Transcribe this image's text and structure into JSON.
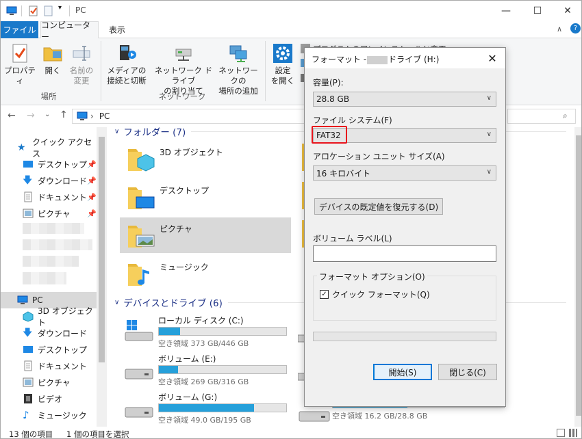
{
  "window": {
    "title": "PC",
    "controls": {
      "minimize": "—",
      "maximize": "☐",
      "close": "✕"
    }
  },
  "tabs": {
    "file": "ファイル",
    "computer": "コンピューター",
    "view": "表示"
  },
  "ribbon": {
    "properties": "プロパティ",
    "open": "開く",
    "rename_line1": "名前の",
    "rename_line2": "変更",
    "group_location": "場所",
    "media_line1": "メディアの",
    "media_line2": "接続と切断",
    "mapdrive_line1": "ネットワーク ドライブ",
    "mapdrive_line2": "の割り当て",
    "addnet_line1": "ネットワークの",
    "addnet_line2": "場所の追加",
    "group_network": "ネットワーク",
    "settings_line1": "設定",
    "settings_line2": "を開く",
    "uninstall": "プログラムのアンインストールと変更"
  },
  "address": {
    "path": "PC"
  },
  "sidebar": {
    "quick_access": "クイック アクセス",
    "quick_items": [
      "デスクトップ",
      "ダウンロード",
      "ドキュメント",
      "ピクチャ"
    ],
    "pc": "PC",
    "pc_items": [
      "3D オブジェクト",
      "ダウンロード",
      "デスクトップ",
      "ドキュメント",
      "ピクチャ",
      "ビデオ",
      "ミュージック"
    ]
  },
  "content": {
    "folders_header": "フォルダー (7)",
    "folders": [
      "3D オブジェクト",
      "デスクトップ",
      "ピクチャ",
      "ミュージック"
    ],
    "drives_header": "デバイスとドライブ (6)",
    "drives": [
      {
        "label": "ローカル ディスク (C:)",
        "space": "空き領域 373 GB/446 GB",
        "used": 0.164
      },
      {
        "label": "ボリューム (E:)",
        "space": "空き領域 269 GB/316 GB",
        "used": 0.149
      },
      {
        "label": "ボリューム (G:)",
        "space": "空き領域 49.0 GB/195 GB",
        "used": 0.749
      }
    ],
    "drive_right_space": "空き領域 16.2 GB/28.8 GB",
    "drive_right_used": 0.4375
  },
  "status": {
    "count": "13 個の項目",
    "selected": "1 個の項目を選択"
  },
  "dialog": {
    "title_prefix": "フォーマット -",
    "title_suffix": "ドライブ (H:)",
    "capacity_label": "容量(P):",
    "capacity_value": "28.8 GB",
    "fs_label": "ファイル システム(F)",
    "fs_value": "FAT32",
    "alloc_label": "アロケーション ユニット サイズ(A)",
    "alloc_value": "16 キロバイト",
    "restore_button": "デバイスの既定値を復元する(D)",
    "volume_label": "ボリューム ラベル(L)",
    "volume_value": "",
    "options_legend": "フォーマット オプション(O)",
    "quick_format": "クイック フォーマット(Q)",
    "start_button": "開始(S)",
    "close_button": "閉じる(C)"
  }
}
